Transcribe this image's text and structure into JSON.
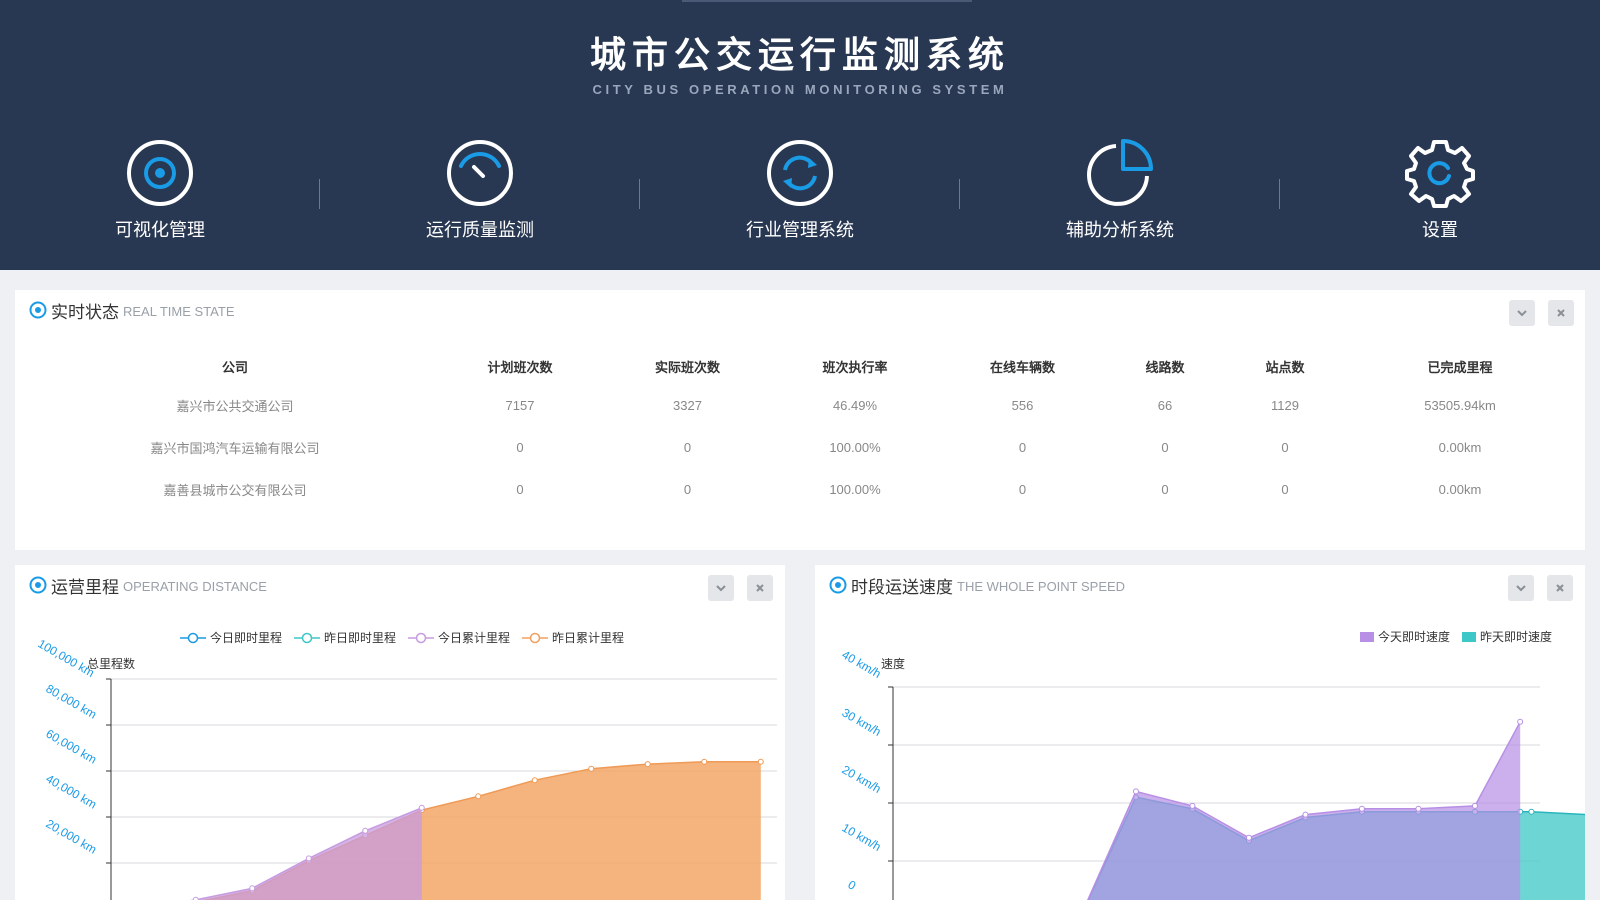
{
  "header": {
    "title": "城市公交运行监测系统",
    "subtitle": "CITY BUS OPERATION MONITORING SYSTEM",
    "nav": [
      {
        "label": "可视化管理",
        "icon": "target-icon"
      },
      {
        "label": "运行质量监测",
        "icon": "gauge-icon"
      },
      {
        "label": "行业管理系统",
        "icon": "refresh-icon"
      },
      {
        "label": "辅助分析系统",
        "icon": "pie-chart-icon"
      },
      {
        "label": "设置",
        "icon": "gear-icon"
      }
    ]
  },
  "colors": {
    "header_bg": "#293852",
    "accent": "#1a9be6",
    "today_speed": "#b78fe5",
    "yesterday_speed": "#3ec7c7",
    "today_cum": "#c79be0",
    "yesterday_cum": "#f2a05e"
  },
  "realtime": {
    "title_cn": "实时状态",
    "title_en": "REAL TIME STATE",
    "columns": [
      "公司",
      "计划班次数",
      "实际班次数",
      "班次执行率",
      "在线车辆数",
      "线路数",
      "站点数",
      "已完成里程"
    ],
    "rows": [
      [
        "嘉兴市公共交通公司",
        "7157",
        "3327",
        "46.49%",
        "556",
        "66",
        "1129",
        "53505.94km"
      ],
      [
        "嘉兴市国鸿汽车运输有限公司",
        "0",
        "0",
        "100.00%",
        "0",
        "0",
        "0",
        "0.00km"
      ],
      [
        "嘉善县城市公交有限公司",
        "0",
        "0",
        "100.00%",
        "0",
        "0",
        "0",
        "0.00km"
      ]
    ]
  },
  "distance": {
    "title_cn": "运营里程",
    "title_en": "OPERATING DISTANCE",
    "chart_data": {
      "type": "area",
      "ylabel": "总里程数",
      "y_tick_labels": [
        "100,000 km",
        "80,000 km",
        "60,000 km",
        "40,000 km",
        "20,000 km"
      ],
      "ylim": [
        0,
        100000
      ],
      "series": [
        {
          "name": "今日即时里程",
          "kind": "line",
          "x": [
            5,
            6,
            7,
            8,
            9,
            10,
            11,
            12
          ],
          "values": [
            0,
            200,
            400,
            600,
            0,
            0,
            200,
            0
          ]
        },
        {
          "name": "昨日即时里程",
          "kind": "line",
          "x": [
            5,
            6,
            7,
            8,
            9,
            10,
            11,
            12
          ],
          "values": [
            0,
            100,
            300,
            500,
            0,
            0,
            100,
            0
          ]
        },
        {
          "name": "今日累计里程",
          "kind": "area",
          "x": [
            4,
            5,
            6,
            7,
            8,
            9
          ],
          "values": [
            0,
            4000,
            9000,
            22000,
            34000,
            44000
          ]
        },
        {
          "name": "昨日累计里程",
          "kind": "area",
          "x": [
            4,
            5,
            6,
            7,
            8,
            9,
            10,
            11,
            12,
            13,
            14,
            15
          ],
          "values": [
            0,
            3000,
            8000,
            21000,
            32000,
            43000,
            49000,
            56000,
            61000,
            63000,
            64000,
            64000
          ]
        }
      ]
    }
  },
  "speed": {
    "title_cn": "时段运送速度",
    "title_en": "THE WHOLE POINT SPEED",
    "chart_data": {
      "type": "area",
      "ylabel": "速度",
      "y_tick_labels": [
        "40 km/h",
        "30 km/h",
        "20 km/h",
        "10 km/h",
        "0"
      ],
      "ylim": [
        0,
        40
      ],
      "series": [
        {
          "name": "今天即时速度",
          "x": [
            3,
            4,
            5,
            6,
            7,
            8,
            9,
            10,
            10.8
          ],
          "values": [
            0,
            22,
            19.5,
            14,
            18,
            19,
            19,
            19.5,
            34
          ]
        },
        {
          "name": "昨天即时速度",
          "x": [
            3,
            4,
            5,
            6,
            7,
            8,
            9,
            10,
            10.8,
            11,
            12,
            13,
            14,
            15,
            16,
            17,
            17.5
          ],
          "values": [
            0,
            21,
            19,
            13.5,
            17.5,
            18.5,
            18.5,
            18.5,
            18.5,
            18.5,
            18,
            17,
            18,
            16.5,
            20,
            22,
            0
          ]
        }
      ]
    }
  }
}
